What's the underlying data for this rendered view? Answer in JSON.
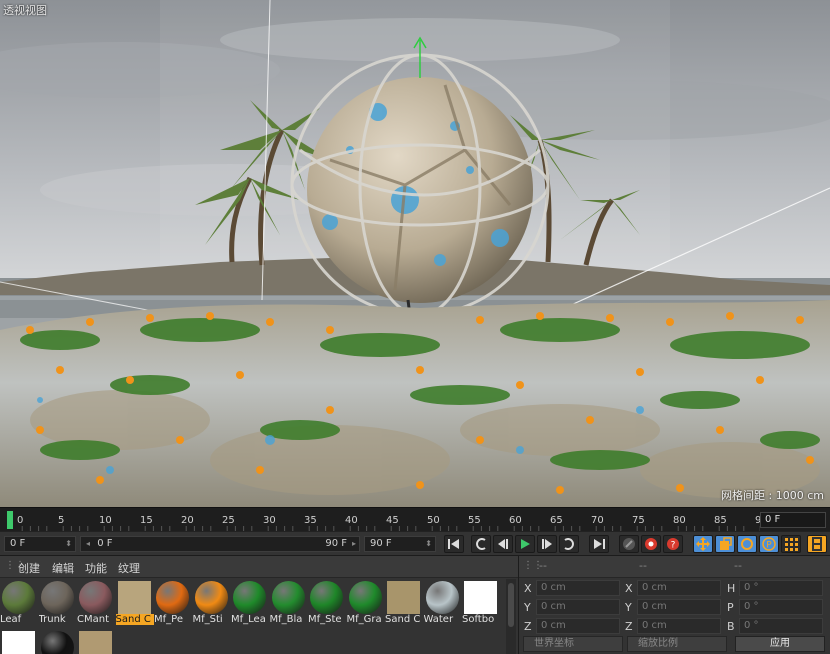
{
  "viewport": {
    "title": "透视视图",
    "grid_spacing": "网格间距 : 1000 cm"
  },
  "timeline": {
    "ticks": [
      "0",
      "5",
      "10",
      "15",
      "20",
      "25",
      "30",
      "35",
      "40",
      "45",
      "50",
      "55",
      "60",
      "65",
      "70",
      "75",
      "80",
      "85",
      "90"
    ],
    "current_frame": "0",
    "end_field": "0 F"
  },
  "transport": {
    "current": "0 F",
    "range_start": "0 F",
    "range_end": "90 F",
    "max": "90 F"
  },
  "materials": {
    "menu": [
      "创建",
      "编辑",
      "功能",
      "纹理"
    ],
    "items": [
      {
        "name": "Leaf",
        "kind": "ball",
        "color": "#5c7a3a"
      },
      {
        "name": "Trunk",
        "kind": "ball",
        "color": "#6d655b"
      },
      {
        "name": "CMant",
        "kind": "ball",
        "color": "#8a5a5e"
      },
      {
        "name": "Sand C",
        "kind": "sq",
        "color": "#b8a57d",
        "selected": true
      },
      {
        "name": "Mf_Pe",
        "kind": "ball",
        "color": "#e06a12"
      },
      {
        "name": "Mf_Sti",
        "kind": "ball",
        "color": "#f08a14"
      },
      {
        "name": "Mf_Lea",
        "kind": "ball",
        "color": "#1f8a2a"
      },
      {
        "name": "Mf_Bla",
        "kind": "ball",
        "color": "#238c2e"
      },
      {
        "name": "Mf_Ste",
        "kind": "ball",
        "color": "#1e8628"
      },
      {
        "name": "Mf_Gra",
        "kind": "ball",
        "color": "#1f8a2b"
      },
      {
        "name": "Sand C",
        "kind": "sq",
        "color": "#a8956b"
      },
      {
        "name": "Water",
        "kind": "ball",
        "color": "#b8c4c8"
      },
      {
        "name": "Softbo",
        "kind": "sq",
        "color": "#ffffff"
      },
      {
        "name": "",
        "kind": "sq",
        "color": "#ffffff"
      },
      {
        "name": "",
        "kind": "ball",
        "color": "#111111"
      },
      {
        "name": "",
        "kind": "sq",
        "color": "#b09a72"
      }
    ]
  },
  "coordinates": {
    "headers": [
      "--",
      "--",
      "--"
    ],
    "rows": [
      {
        "l1": "X",
        "v1": "0 cm",
        "l2": "X",
        "v2": "0 cm",
        "l3": "H",
        "v3": "0 °"
      },
      {
        "l1": "Y",
        "v1": "0 cm",
        "l2": "Y",
        "v2": "0 cm",
        "l3": "P",
        "v3": "0 °"
      },
      {
        "l1": "Z",
        "v1": "0 cm",
        "l2": "Z",
        "v2": "0 cm",
        "l3": "B",
        "v3": "0 °"
      }
    ],
    "mode_dropdown": "世界坐标",
    "scale_dropdown": "缩放比例",
    "apply": "应用"
  },
  "colors": {
    "accent_orange": "#f5a623",
    "play_green": "#3ec96b",
    "record_red": "#d93a2e",
    "active_blue": "#4d8fd6"
  }
}
